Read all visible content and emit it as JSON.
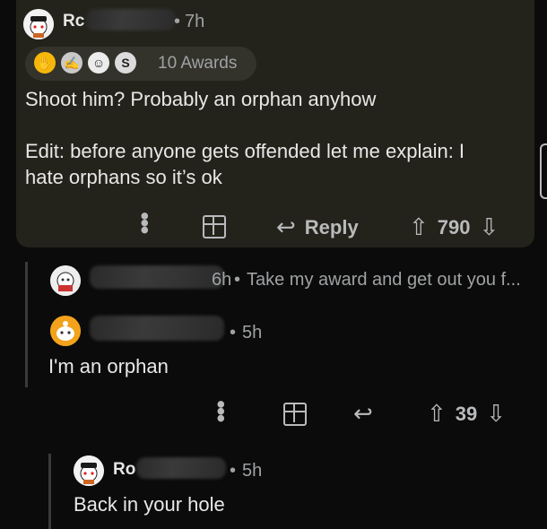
{
  "comments": [
    {
      "username": "Rc",
      "time": "7h",
      "awards_label": "10 Awards",
      "body_lines": [
        "Shoot him? Probably an orphan anyhow",
        "",
        "Edit: before anyone gets offended let me explain: I",
        "hate orphans so it’s ok"
      ],
      "reply_label": "Reply",
      "score": "790"
    },
    {
      "time": "6h",
      "body": "Take my award and get out you f..."
    },
    {
      "time": "5h",
      "body": "I'm an orphan",
      "score": "39"
    },
    {
      "username": "Ro",
      "time": "5h",
      "body": "Back in your hole"
    }
  ],
  "separator": "•",
  "icons": [
    "avatar-icon",
    "award-icons",
    "more-options-icon",
    "gift-icon",
    "reply-arrow-icon",
    "upvote-icon",
    "downvote-icon"
  ],
  "colors": {
    "highlight_card": "#24231b",
    "background": "#0b0b0b"
  }
}
